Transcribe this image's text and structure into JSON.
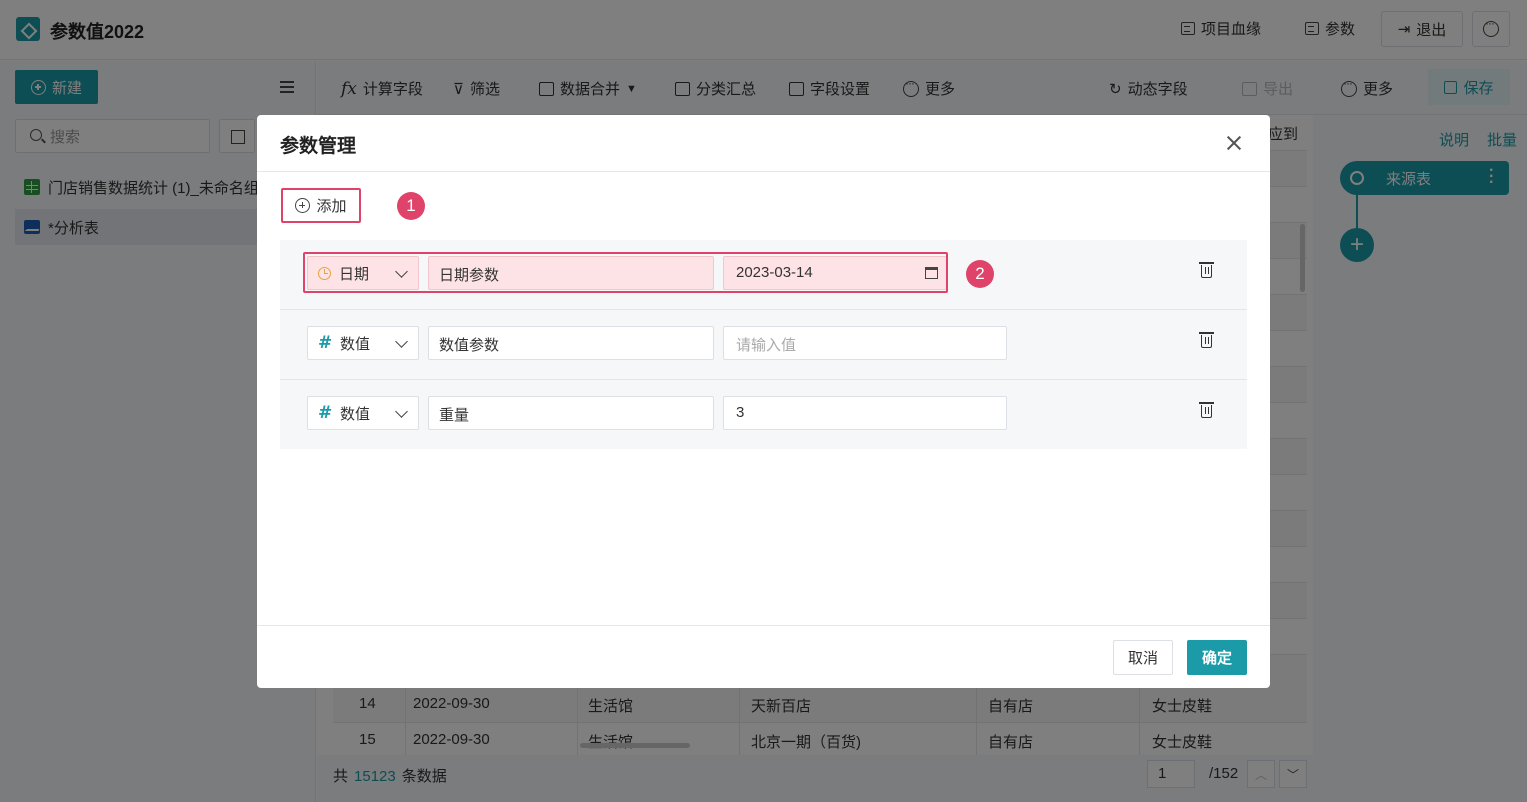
{
  "header": {
    "title": "参数值2022",
    "lineage_label": "项目血缘",
    "params_label": "参数",
    "logout_label": "退出",
    "icons": {
      "app": "app-folder-icon",
      "more": "more-dots-icon"
    }
  },
  "sidebar": {
    "new_label": "新建",
    "search_placeholder": "搜索",
    "items": [
      {
        "label": "门店销售数据统计 (1)_未命名组",
        "icon": "sheet-icon"
      },
      {
        "label": "*分析表",
        "icon": "chart-icon"
      }
    ]
  },
  "toolbar": {
    "calc_field": "计算字段",
    "filter": "筛选",
    "merge": "数据合并",
    "group_summary": "分类汇总",
    "field_settings": "字段设置",
    "more": "更多",
    "dynamic_field": "动态字段",
    "export": "导出",
    "more_right": "更多",
    "save": "保存"
  },
  "table": {
    "header_fragment": "应到",
    "rows": [
      {
        "no": "14",
        "date": "2022-09-30",
        "category": "生活馆",
        "store": "天新百店",
        "store_type": "自有店",
        "product": "女士皮鞋"
      },
      {
        "no": "15",
        "date": "2022-09-30",
        "category": "生活馆",
        "store": "北京一期（百货)",
        "store_type": "自有店",
        "product": "女士皮鞋"
      }
    ],
    "footer": {
      "prefix": "共",
      "count": "15123",
      "suffix": "条数据",
      "page": "1",
      "total_pages": "/152"
    }
  },
  "right_panel": {
    "explain": "说明",
    "batch": "批量",
    "source_node": "来源表"
  },
  "modal": {
    "title": "参数管理",
    "add_label": "添加",
    "badge_1": "1",
    "badge_2": "2",
    "params": [
      {
        "type": "日期",
        "type_icon": "clock-icon",
        "name": "日期参数",
        "value": "2023-03-14",
        "placeholder": ""
      },
      {
        "type": "数值",
        "type_icon": "hash-icon",
        "name": "数值参数",
        "value": "",
        "placeholder": "请输入值"
      },
      {
        "type": "数值",
        "type_icon": "hash-icon",
        "name": "重量",
        "value": "3",
        "placeholder": ""
      }
    ],
    "cancel_label": "取消",
    "confirm_label": "确定"
  },
  "colors": {
    "accent": "#1b9aa8",
    "highlight": "#e0436a",
    "highlight_fill": "#fde3e6",
    "date_icon": "#e8a33a"
  }
}
